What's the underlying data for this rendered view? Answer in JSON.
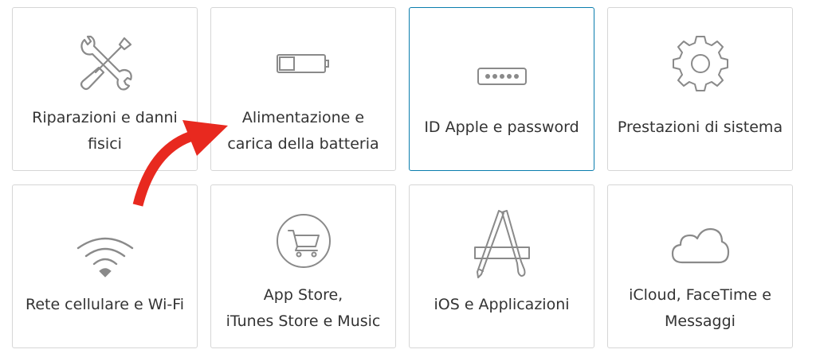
{
  "colors": {
    "border": "#d6d6d6",
    "selected_border": "#0a7dad",
    "icon_stroke": "#8a8a8a",
    "text": "#333333",
    "arrow": "#e8291f"
  },
  "tiles": [
    {
      "icon": "wrench-screwdriver-icon",
      "line1": "Riparazioni e danni",
      "line2": "fisici"
    },
    {
      "icon": "battery-icon",
      "line1": "Alimentazione e",
      "line2": "carica della batteria"
    },
    {
      "icon": "password-dots-icon",
      "line1": "ID Apple e password",
      "selected": true
    },
    {
      "icon": "gear-icon",
      "line1": "Prestazioni di sistema"
    },
    {
      "icon": "wifi-icon",
      "line1": "Rete cellulare e Wi-Fi"
    },
    {
      "icon": "shopping-cart-icon",
      "line1": "App Store,",
      "line2": "iTunes Store e Music"
    },
    {
      "icon": "app-store-icon",
      "line1": "iOS e Applicazioni"
    },
    {
      "icon": "cloud-icon",
      "line1": "iCloud, FaceTime e",
      "line2": "Messaggi"
    }
  ],
  "annotation": {
    "icon": "curved-arrow-icon"
  }
}
